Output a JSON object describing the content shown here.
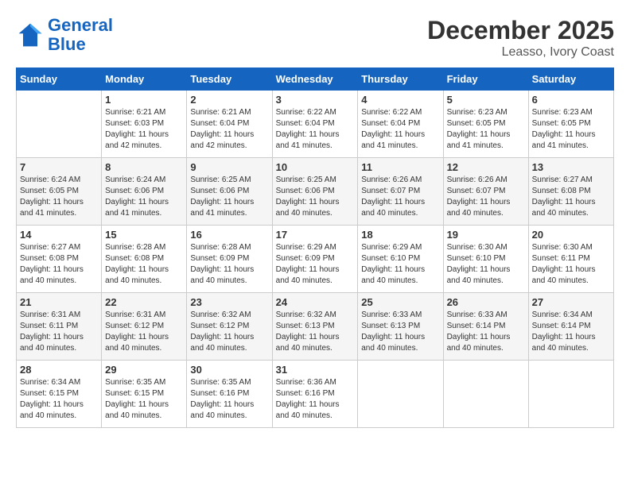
{
  "logo": {
    "line1": "General",
    "line2": "Blue"
  },
  "title": "December 2025",
  "subtitle": "Leasso, Ivory Coast",
  "days_of_week": [
    "Sunday",
    "Monday",
    "Tuesday",
    "Wednesday",
    "Thursday",
    "Friday",
    "Saturday"
  ],
  "weeks": [
    [
      {
        "day": "",
        "sunrise": "",
        "sunset": "",
        "daylight": ""
      },
      {
        "day": "1",
        "sunrise": "Sunrise: 6:21 AM",
        "sunset": "Sunset: 6:03 PM",
        "daylight": "Daylight: 11 hours and 42 minutes."
      },
      {
        "day": "2",
        "sunrise": "Sunrise: 6:21 AM",
        "sunset": "Sunset: 6:04 PM",
        "daylight": "Daylight: 11 hours and 42 minutes."
      },
      {
        "day": "3",
        "sunrise": "Sunrise: 6:22 AM",
        "sunset": "Sunset: 6:04 PM",
        "daylight": "Daylight: 11 hours and 41 minutes."
      },
      {
        "day": "4",
        "sunrise": "Sunrise: 6:22 AM",
        "sunset": "Sunset: 6:04 PM",
        "daylight": "Daylight: 11 hours and 41 minutes."
      },
      {
        "day": "5",
        "sunrise": "Sunrise: 6:23 AM",
        "sunset": "Sunset: 6:05 PM",
        "daylight": "Daylight: 11 hours and 41 minutes."
      },
      {
        "day": "6",
        "sunrise": "Sunrise: 6:23 AM",
        "sunset": "Sunset: 6:05 PM",
        "daylight": "Daylight: 11 hours and 41 minutes."
      }
    ],
    [
      {
        "day": "7",
        "sunrise": "Sunrise: 6:24 AM",
        "sunset": "Sunset: 6:05 PM",
        "daylight": "Daylight: 11 hours and 41 minutes."
      },
      {
        "day": "8",
        "sunrise": "Sunrise: 6:24 AM",
        "sunset": "Sunset: 6:06 PM",
        "daylight": "Daylight: 11 hours and 41 minutes."
      },
      {
        "day": "9",
        "sunrise": "Sunrise: 6:25 AM",
        "sunset": "Sunset: 6:06 PM",
        "daylight": "Daylight: 11 hours and 41 minutes."
      },
      {
        "day": "10",
        "sunrise": "Sunrise: 6:25 AM",
        "sunset": "Sunset: 6:06 PM",
        "daylight": "Daylight: 11 hours and 40 minutes."
      },
      {
        "day": "11",
        "sunrise": "Sunrise: 6:26 AM",
        "sunset": "Sunset: 6:07 PM",
        "daylight": "Daylight: 11 hours and 40 minutes."
      },
      {
        "day": "12",
        "sunrise": "Sunrise: 6:26 AM",
        "sunset": "Sunset: 6:07 PM",
        "daylight": "Daylight: 11 hours and 40 minutes."
      },
      {
        "day": "13",
        "sunrise": "Sunrise: 6:27 AM",
        "sunset": "Sunset: 6:08 PM",
        "daylight": "Daylight: 11 hours and 40 minutes."
      }
    ],
    [
      {
        "day": "14",
        "sunrise": "Sunrise: 6:27 AM",
        "sunset": "Sunset: 6:08 PM",
        "daylight": "Daylight: 11 hours and 40 minutes."
      },
      {
        "day": "15",
        "sunrise": "Sunrise: 6:28 AM",
        "sunset": "Sunset: 6:08 PM",
        "daylight": "Daylight: 11 hours and 40 minutes."
      },
      {
        "day": "16",
        "sunrise": "Sunrise: 6:28 AM",
        "sunset": "Sunset: 6:09 PM",
        "daylight": "Daylight: 11 hours and 40 minutes."
      },
      {
        "day": "17",
        "sunrise": "Sunrise: 6:29 AM",
        "sunset": "Sunset: 6:09 PM",
        "daylight": "Daylight: 11 hours and 40 minutes."
      },
      {
        "day": "18",
        "sunrise": "Sunrise: 6:29 AM",
        "sunset": "Sunset: 6:10 PM",
        "daylight": "Daylight: 11 hours and 40 minutes."
      },
      {
        "day": "19",
        "sunrise": "Sunrise: 6:30 AM",
        "sunset": "Sunset: 6:10 PM",
        "daylight": "Daylight: 11 hours and 40 minutes."
      },
      {
        "day": "20",
        "sunrise": "Sunrise: 6:30 AM",
        "sunset": "Sunset: 6:11 PM",
        "daylight": "Daylight: 11 hours and 40 minutes."
      }
    ],
    [
      {
        "day": "21",
        "sunrise": "Sunrise: 6:31 AM",
        "sunset": "Sunset: 6:11 PM",
        "daylight": "Daylight: 11 hours and 40 minutes."
      },
      {
        "day": "22",
        "sunrise": "Sunrise: 6:31 AM",
        "sunset": "Sunset: 6:12 PM",
        "daylight": "Daylight: 11 hours and 40 minutes."
      },
      {
        "day": "23",
        "sunrise": "Sunrise: 6:32 AM",
        "sunset": "Sunset: 6:12 PM",
        "daylight": "Daylight: 11 hours and 40 minutes."
      },
      {
        "day": "24",
        "sunrise": "Sunrise: 6:32 AM",
        "sunset": "Sunset: 6:13 PM",
        "daylight": "Daylight: 11 hours and 40 minutes."
      },
      {
        "day": "25",
        "sunrise": "Sunrise: 6:33 AM",
        "sunset": "Sunset: 6:13 PM",
        "daylight": "Daylight: 11 hours and 40 minutes."
      },
      {
        "day": "26",
        "sunrise": "Sunrise: 6:33 AM",
        "sunset": "Sunset: 6:14 PM",
        "daylight": "Daylight: 11 hours and 40 minutes."
      },
      {
        "day": "27",
        "sunrise": "Sunrise: 6:34 AM",
        "sunset": "Sunset: 6:14 PM",
        "daylight": "Daylight: 11 hours and 40 minutes."
      }
    ],
    [
      {
        "day": "28",
        "sunrise": "Sunrise: 6:34 AM",
        "sunset": "Sunset: 6:15 PM",
        "daylight": "Daylight: 11 hours and 40 minutes."
      },
      {
        "day": "29",
        "sunrise": "Sunrise: 6:35 AM",
        "sunset": "Sunset: 6:15 PM",
        "daylight": "Daylight: 11 hours and 40 minutes."
      },
      {
        "day": "30",
        "sunrise": "Sunrise: 6:35 AM",
        "sunset": "Sunset: 6:16 PM",
        "daylight": "Daylight: 11 hours and 40 minutes."
      },
      {
        "day": "31",
        "sunrise": "Sunrise: 6:36 AM",
        "sunset": "Sunset: 6:16 PM",
        "daylight": "Daylight: 11 hours and 40 minutes."
      },
      {
        "day": "",
        "sunrise": "",
        "sunset": "",
        "daylight": ""
      },
      {
        "day": "",
        "sunrise": "",
        "sunset": "",
        "daylight": ""
      },
      {
        "day": "",
        "sunrise": "",
        "sunset": "",
        "daylight": ""
      }
    ]
  ]
}
